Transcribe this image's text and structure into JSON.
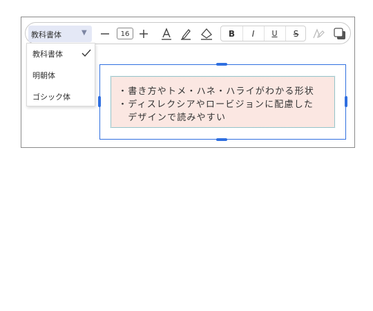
{
  "toolbar": {
    "font_family": "教科書体",
    "font_size": "16",
    "format_buttons": [
      "B",
      "I",
      "U",
      "S"
    ]
  },
  "font_menu": {
    "items": [
      {
        "label": "教科書体",
        "selected": true
      },
      {
        "label": "明朝体",
        "selected": false
      },
      {
        "label": "ゴシック体",
        "selected": false
      }
    ]
  },
  "textbox": {
    "lines": [
      "・書き方やトメ・ハネ・ハライがわかる形状",
      "・ディスレクシアやロービジョンに配慮した",
      "　デザインで読みやすい"
    ],
    "background_color": "#fbe7e2"
  },
  "colors": {
    "accent": "#2f6fe0",
    "select_bg": "#e4e8f6"
  },
  "icons": [
    "minus-icon",
    "plus-icon",
    "text-color-icon",
    "highlight-pen-icon",
    "eraser-icon",
    "clear-format-icon",
    "shadow-icon",
    "checkmark-icon",
    "dropdown-caret-icon"
  ]
}
